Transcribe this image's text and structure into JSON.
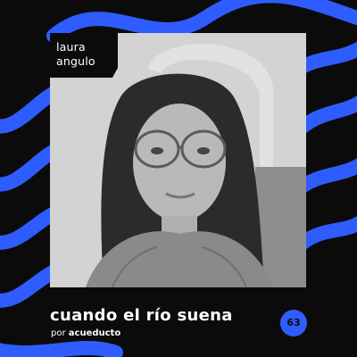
{
  "cover": {
    "guest_name_line1": "laura",
    "guest_name_line2": "angulo",
    "title": "cuando el río suena",
    "byline_prefix": "por",
    "byline_brand": "acueducto",
    "episode_number": "63"
  },
  "colors": {
    "background": "#0b0b0b",
    "accent_blue": "#2f5cff",
    "text": "#ffffff"
  },
  "icons": {
    "decoration": "wave-stripes"
  }
}
